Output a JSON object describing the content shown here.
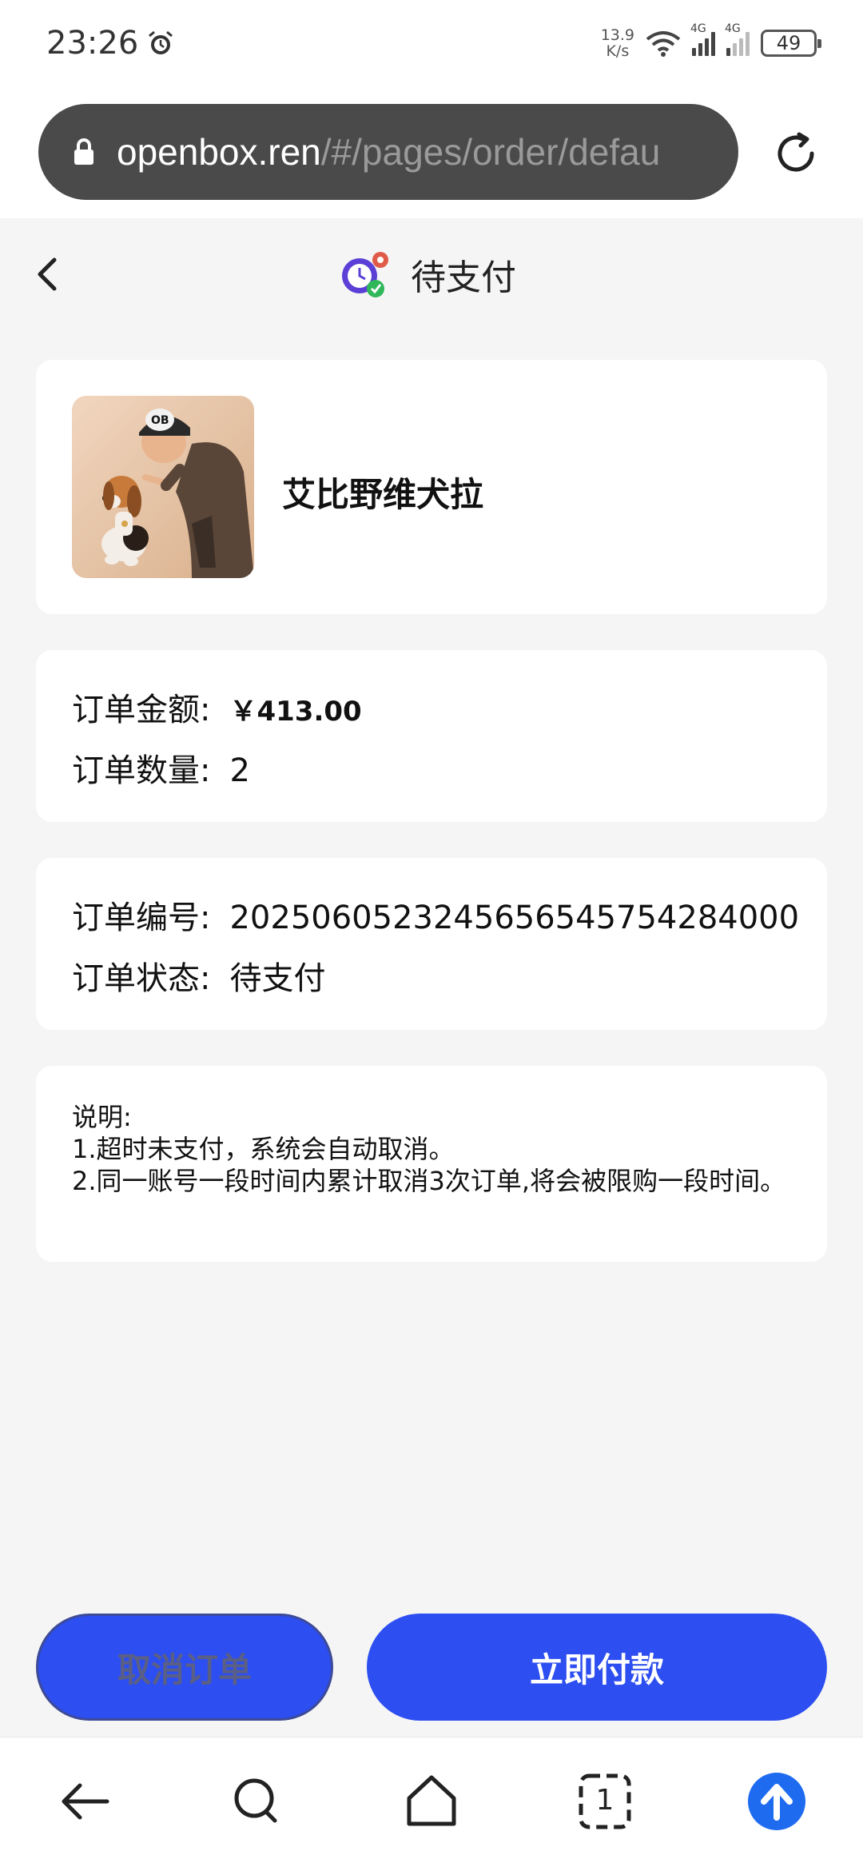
{
  "status_bar": {
    "time": "23:26",
    "alarm_icon": "alarm-clock-icon",
    "net_speed_value": "13.9",
    "net_speed_unit": "K/s",
    "sim1_label": "4G",
    "sim2_label": "4G",
    "battery": "49"
  },
  "browser": {
    "url_host": "openbox.ren",
    "url_path": "/#/pages/order/defau",
    "lock_icon": "lock-icon",
    "reload_icon": "reload-icon"
  },
  "header": {
    "title": "待支付",
    "back_icon": "chevron-left-icon",
    "status_icon": "clock-gear-check-icon"
  },
  "product": {
    "name": "艾比野维犬拉",
    "image_badge": "OB"
  },
  "order_amount": {
    "amount_label": "订单金额:",
    "amount_value": "￥413.00",
    "quantity_label": "订单数量:",
    "quantity_value": "2"
  },
  "order_info": {
    "number_label": "订单编号:",
    "number_value": "20250605232456565457542840​00",
    "status_label": "订单状态:",
    "status_value": "待支付"
  },
  "note": {
    "title": "说明:",
    "line1": "1.超时未支付，系统会自动取消。",
    "line2": "2.同一账号一段时间内累计取消3次订单,将会被限购一段时间。"
  },
  "actions": {
    "cancel_label": "取消订单",
    "pay_label": "立即付款"
  },
  "bottom_nav": {
    "tabs_count": "1"
  },
  "colors": {
    "primary": "#2d4ef0",
    "page_bg": "#f5f5f5",
    "upload_blue": "#1f6bf0"
  }
}
